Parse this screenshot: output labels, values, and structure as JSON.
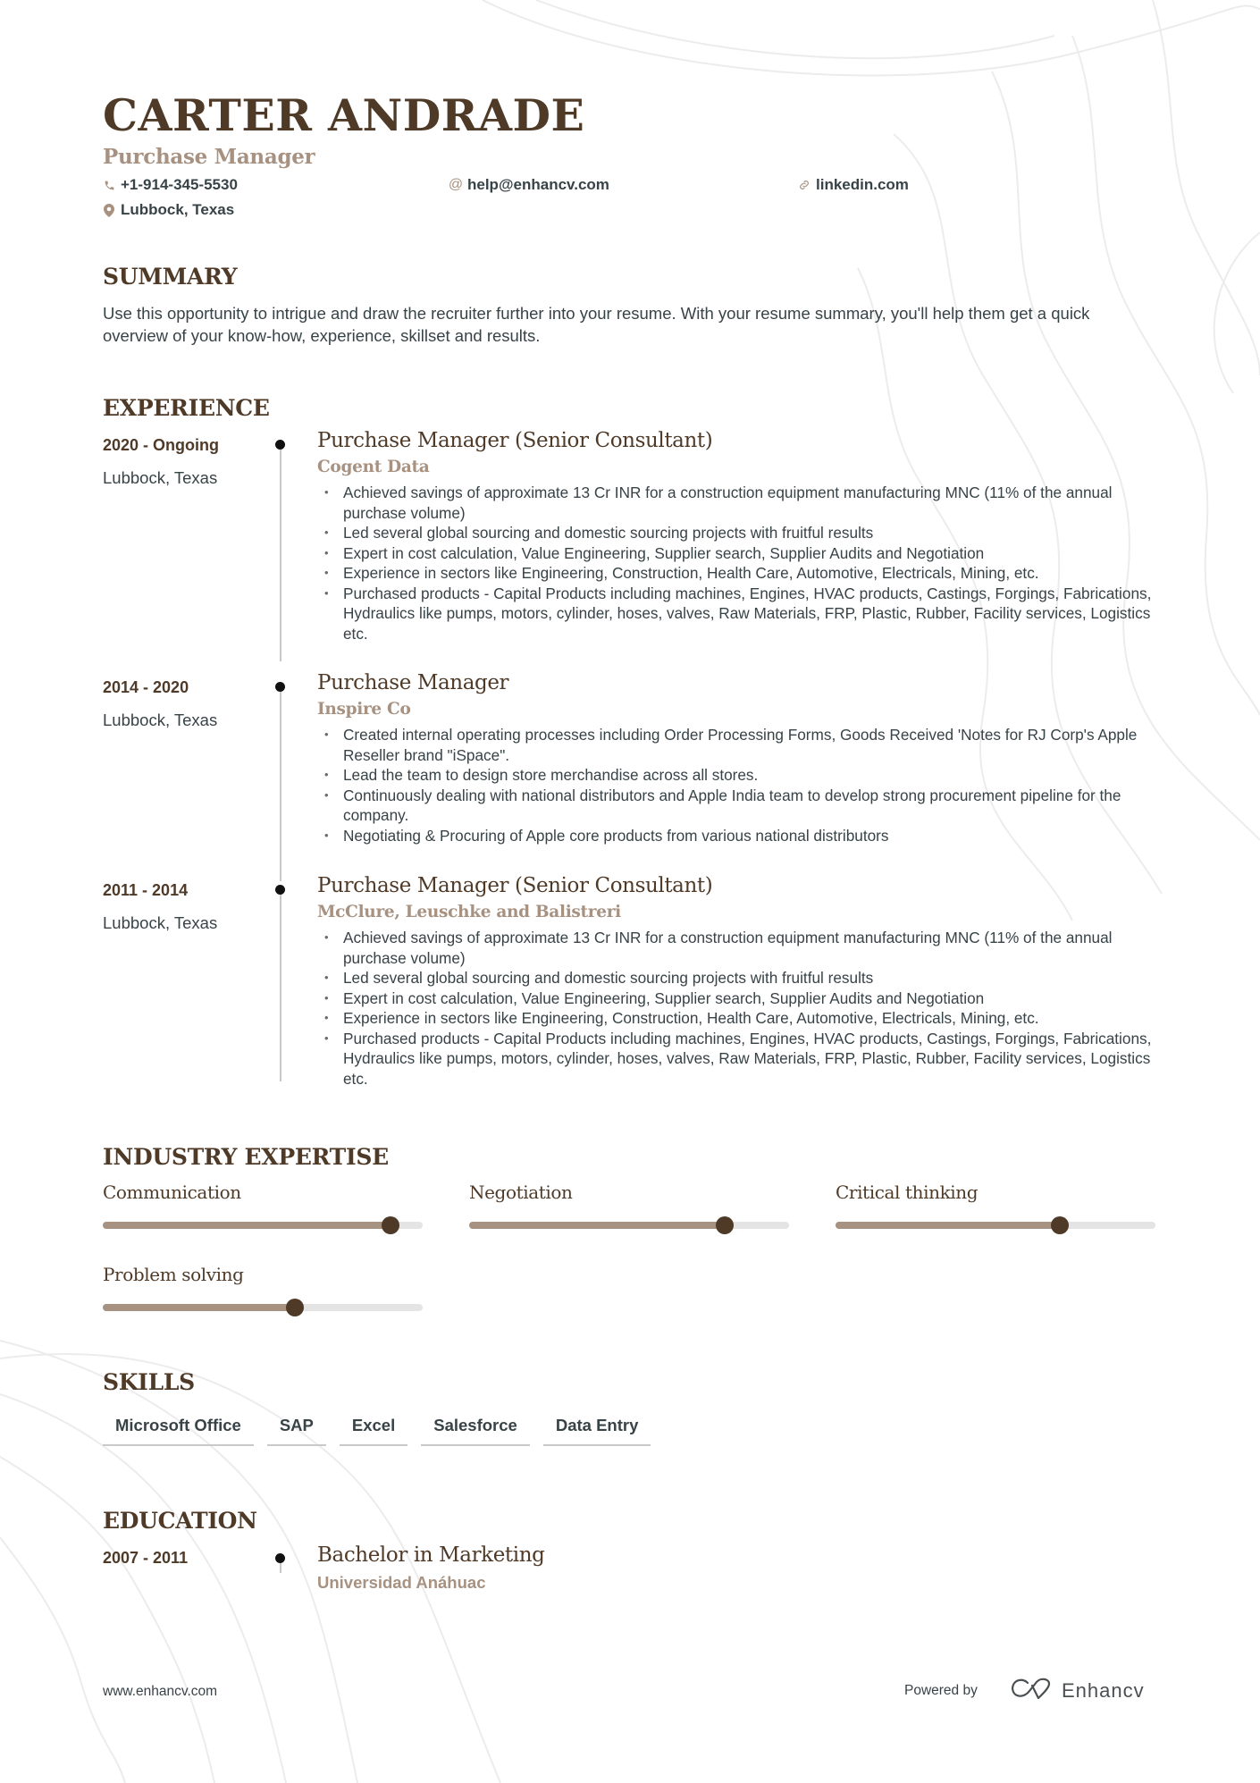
{
  "header": {
    "name": "CARTER ANDRADE",
    "title": "Purchase Manager",
    "phone": "+1-914-345-5530",
    "email": "help@enhancv.com",
    "link": "linkedin.com",
    "location": "Lubbock, Texas",
    "icons": {
      "phone": "phone-icon",
      "email": "at-icon",
      "link": "link-icon",
      "location": "map-pin-icon"
    }
  },
  "summary": {
    "heading": "SUMMARY",
    "text": "Use this opportunity to intrigue and draw the recruiter further into your resume. With your resume summary, you'll help them get a quick overview of your know-how, experience, skillset and results."
  },
  "experience": {
    "heading": "EXPERIENCE",
    "items": [
      {
        "date": "2020 - Ongoing",
        "location": "Lubbock, Texas",
        "role": "Purchase Manager (Senior Consultant)",
        "company": "Cogent Data",
        "bullets": [
          "Achieved savings of approximate 13 Cr INR for a construction equipment manufacturing MNC (11% of the annual purchase volume)",
          "Led several global sourcing and domestic sourcing projects with fruitful results",
          "Expert in cost calculation, Value Engineering, Supplier search, Supplier Audits and Negotiation",
          "Experience in sectors like Engineering, Construction, Health Care, Automotive, Electricals, Mining, etc.",
          "Purchased products - Capital Products including machines, Engines, HVAC products, Castings, Forgings, Fabrications, Hydraulics like pumps, motors, cylinder, hoses, valves, Raw Materials, FRP, Plastic, Rubber, Facility services, Logistics etc."
        ]
      },
      {
        "date": "2014 - 2020",
        "location": "Lubbock, Texas",
        "role": "Purchase Manager",
        "company": "Inspire Co",
        "bullets": [
          "Created internal operating processes including Order Processing Forms,  Goods Received 'Notes for RJ Corp's Apple Reseller brand \"iSpace\".",
          "Lead the team to design store merchandise across all stores.",
          "Continuously dealing with national distributors and Apple India team to develop strong procurement pipeline for the company.",
          "Negotiating & Procuring of Apple core products from various national distributors"
        ]
      },
      {
        "date": "2011 - 2014",
        "location": "Lubbock, Texas",
        "role": "Purchase Manager (Senior Consultant)",
        "company": "McClure, Leuschke and Balistreri",
        "bullets": [
          "Achieved savings of approximate 13 Cr INR for a construction equipment manufacturing MNC (11% of the annual purchase volume)",
          "Led several global sourcing and domestic sourcing projects with fruitful results",
          "Expert in cost calculation, Value Engineering, Supplier search, Supplier Audits and Negotiation",
          "Experience in sectors like Engineering, Construction, Health Care, Automotive, Electricals, Mining, etc.",
          "Purchased products - Capital Products including machines, Engines, HVAC products, Castings, Forgings, Fabrications, Hydraulics like pumps, motors, cylinder, hoses, valves, Raw Materials, FRP, Plastic, Rubber, Facility services, Logistics etc."
        ]
      }
    ]
  },
  "expertise": {
    "heading": "INDUSTRY EXPERTISE",
    "items": [
      {
        "label": "Communication",
        "level": 0.9
      },
      {
        "label": "Negotiation",
        "level": 0.8
      },
      {
        "label": "Critical thinking",
        "level": 0.7
      },
      {
        "label": "Problem solving",
        "level": 0.6
      }
    ]
  },
  "skills": {
    "heading": "SKILLS",
    "items": [
      "Microsoft Office",
      "SAP",
      "Excel",
      "Salesforce",
      "Data Entry"
    ]
  },
  "education": {
    "heading": "EDUCATION",
    "items": [
      {
        "date": "2007 - 2011",
        "degree": "Bachelor in Marketing",
        "school": "Universidad Anáhuac"
      }
    ]
  },
  "footer": {
    "url": "www.enhancv.com",
    "powered_by": "Powered by",
    "brand": "Enhancv"
  },
  "colors": {
    "heading": "#4f3a28",
    "accent": "#a79180",
    "text": "#384347",
    "track": "#e4e4e4"
  }
}
